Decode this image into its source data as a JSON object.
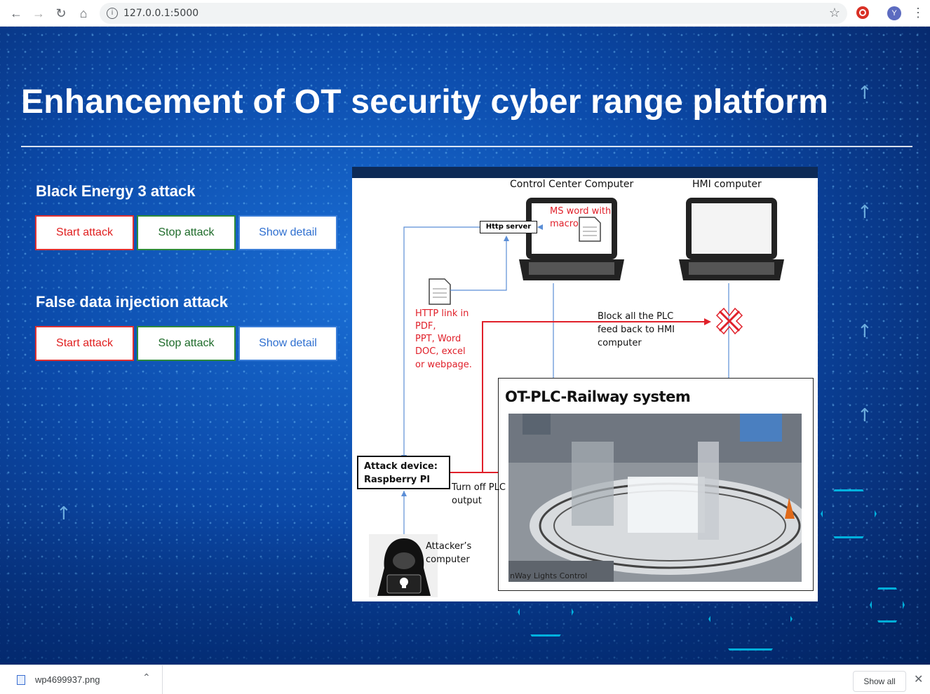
{
  "browser": {
    "url": "127.0.0.1:5000",
    "avatar_initial": "Y"
  },
  "page": {
    "title": "Enhancement of OT security cyber range platform",
    "sections": [
      {
        "title": "Black Energy 3 attack",
        "start_label": "Start attack",
        "stop_label": "Stop attack",
        "detail_label": "Show detail"
      },
      {
        "title": "False data injection attack",
        "start_label": "Start attack",
        "stop_label": "Stop attack",
        "detail_label": "Show detail"
      }
    ]
  },
  "diagram": {
    "control_center": "Control Center Computer",
    "hmi": "HMI computer",
    "ms_word": "MS word with",
    "macro": "macro",
    "http_server": "Http server",
    "http_link_lines": [
      "HTTP link in",
      "PDF,",
      "PPT, Word",
      "DOC, excel",
      "or webpage."
    ],
    "block_lines": [
      "Block all the PLC",
      "feed back to HMI",
      "computer"
    ],
    "plc_title": "OT-PLC-Railway system",
    "attack_device_lines": [
      "Attack device:",
      "Raspberry PI"
    ],
    "turn_off_lines": [
      "Turn off PLC",
      "output"
    ],
    "attacker_lines": [
      "Attacker’s",
      "computer"
    ],
    "photo_caption": "nWay Lights Control"
  },
  "downloads": {
    "file_name": "wp4699937.png",
    "show_all": "Show all"
  },
  "colors": {
    "start": "#e02020",
    "stop": "#1e6b2a",
    "detail": "#2e6fd0"
  }
}
